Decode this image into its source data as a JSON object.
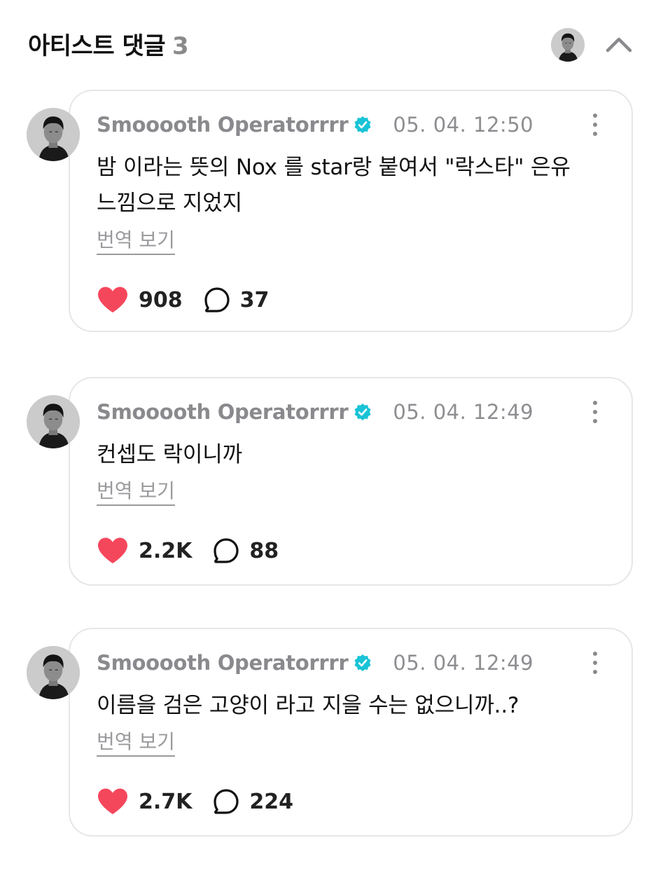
{
  "header": {
    "title": "아티스트 댓글",
    "count": "3",
    "avatar_icon": "profile-avatar",
    "collapse_icon": "chevron-up-icon"
  },
  "colors": {
    "verified": "#18c3d6",
    "like": "#f5475c",
    "muted": "#8a8a8e",
    "card_border": "#e6e6ea"
  },
  "comments": [
    {
      "author": "Smooooth Operatorrrr",
      "time": "05. 04. 12:50",
      "text": "밤 이라는 뜻의 Nox 를 star랑 붙여서 \"락스타\" 은유 느낌으로 지었지",
      "translate": "번역 보기",
      "likes": "908",
      "replies": "37"
    },
    {
      "author": "Smooooth Operatorrrr",
      "time": "05. 04. 12:49",
      "text": "컨셉도 락이니까",
      "translate": "번역 보기",
      "likes": "2.2K",
      "replies": "88"
    },
    {
      "author": "Smooooth Operatorrrr",
      "time": "05. 04. 12:49",
      "text": "이름을 검은 고양이 라고 지을 수는 없으니까..?",
      "translate": "번역 보기",
      "likes": "2.7K",
      "replies": "224"
    }
  ]
}
